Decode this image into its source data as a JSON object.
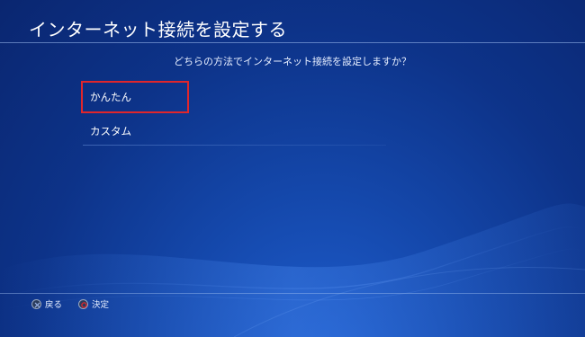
{
  "header": {
    "title": "インターネット接続を設定する"
  },
  "prompt": "どちらの方法でインターネット接続を設定しますか？",
  "options": [
    {
      "label": "かんたん",
      "selected": true
    },
    {
      "label": "カスタム",
      "selected": false
    }
  ],
  "footer": {
    "back": {
      "icon": "cross-button-icon",
      "label": "戻る"
    },
    "confirm": {
      "icon": "circle-button-icon",
      "label": "決定"
    }
  },
  "colors": {
    "background": "#0d3389",
    "selection_outline": "#e0262b",
    "circle_button": "#e0262b",
    "cross_button": "#9ab3e8"
  }
}
